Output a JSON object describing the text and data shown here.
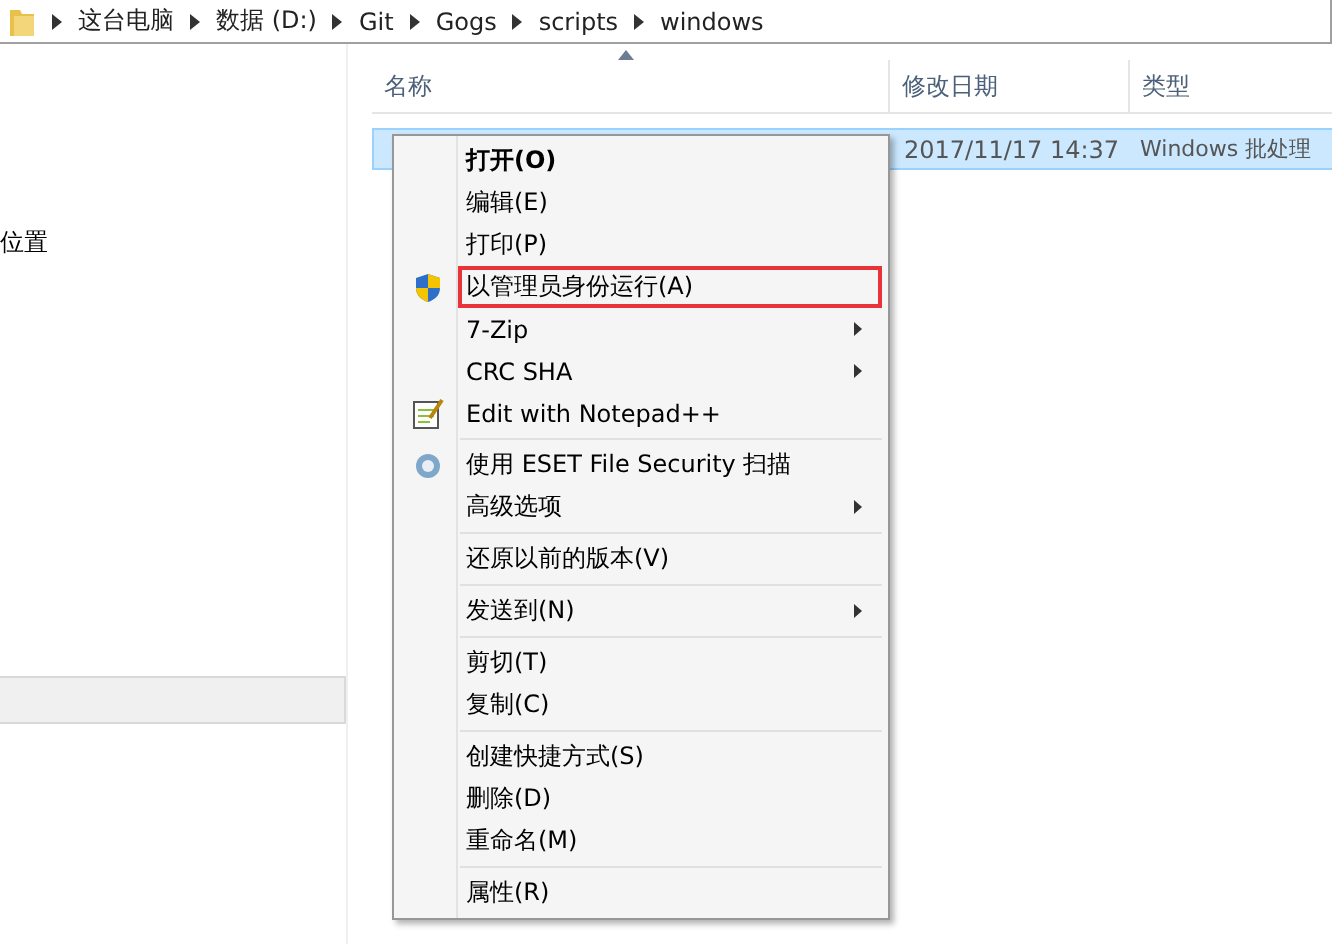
{
  "address_bar": {
    "path": [
      "这台电脑",
      "数据 (D:)",
      "Git",
      "Gogs",
      "scripts",
      "windows"
    ]
  },
  "navigation_pane": {
    "items": [
      "位置"
    ]
  },
  "file_list": {
    "columns": [
      "名称",
      "修改日期",
      "类型"
    ],
    "rows": [
      {
        "date": "2017/11/17 14:37",
        "type": "Windows 批处理",
        "selected": true
      }
    ]
  },
  "context_menu": {
    "items": [
      {
        "label": "打开(O)",
        "kind": "item",
        "bold": true,
        "submenu": false,
        "highlighted": false
      },
      {
        "label": "编辑(E)",
        "kind": "item",
        "bold": false,
        "submenu": false,
        "highlighted": false
      },
      {
        "label": "打印(P)",
        "kind": "item",
        "bold": false,
        "submenu": false,
        "highlighted": false
      },
      {
        "label": "以管理员身份运行(A)",
        "kind": "shield",
        "bold": false,
        "submenu": false,
        "highlighted": true
      },
      {
        "label": "7-Zip",
        "kind": "item",
        "bold": false,
        "submenu": true,
        "highlighted": false
      },
      {
        "label": "CRC SHA",
        "kind": "item",
        "bold": false,
        "submenu": true,
        "highlighted": false
      },
      {
        "label": "Edit with Notepad++",
        "kind": "notepad",
        "bold": false,
        "submenu": false,
        "highlighted": false
      },
      {
        "kind": "separator"
      },
      {
        "label": "使用 ESET File Security 扫描",
        "kind": "scan",
        "bold": false,
        "submenu": false,
        "highlighted": false
      },
      {
        "label": "高级选项",
        "kind": "item",
        "bold": false,
        "submenu": true,
        "highlighted": false
      },
      {
        "kind": "separator"
      },
      {
        "label": "还原以前的版本(V)",
        "kind": "item",
        "bold": false,
        "submenu": false,
        "highlighted": false
      },
      {
        "kind": "separator"
      },
      {
        "label": "发送到(N)",
        "kind": "item",
        "bold": false,
        "submenu": true,
        "highlighted": false
      },
      {
        "kind": "separator"
      },
      {
        "label": "剪切(T)",
        "kind": "item",
        "bold": false,
        "submenu": false,
        "highlighted": false
      },
      {
        "label": "复制(C)",
        "kind": "item",
        "bold": false,
        "submenu": false,
        "highlighted": false
      },
      {
        "kind": "separator"
      },
      {
        "label": "创建快捷方式(S)",
        "kind": "item",
        "bold": false,
        "submenu": false,
        "highlighted": false
      },
      {
        "label": "删除(D)",
        "kind": "item",
        "bold": false,
        "submenu": false,
        "highlighted": false
      },
      {
        "label": "重命名(M)",
        "kind": "item",
        "bold": false,
        "submenu": false,
        "highlighted": false
      },
      {
        "kind": "separator"
      },
      {
        "label": "属性(R)",
        "kind": "item",
        "bold": false,
        "submenu": false,
        "highlighted": false
      }
    ]
  }
}
